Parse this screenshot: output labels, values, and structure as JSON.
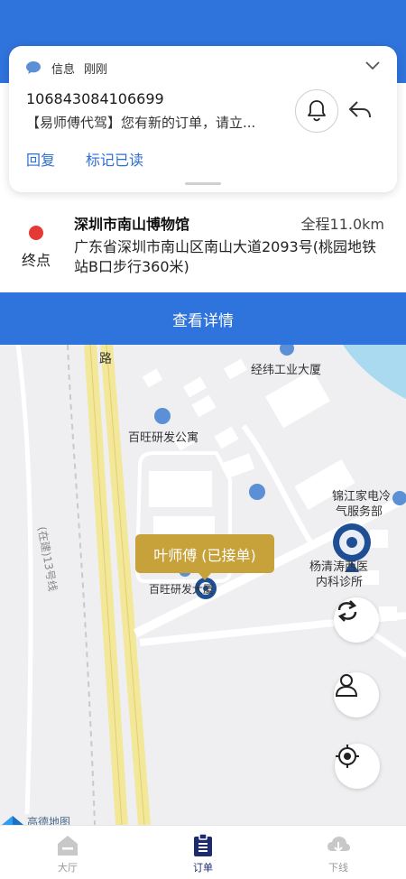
{
  "notification": {
    "app": "信息",
    "time": "刚刚",
    "sender": "106843084106699",
    "message": "【易师傅代驾】您有新的订单，请立...",
    "actions": {
      "reply": "回复",
      "mark_read": "标记已读"
    }
  },
  "destination": {
    "name": "深圳市南山博物馆",
    "distance": "全程11.0km",
    "label": "终点",
    "address": "广东省深圳市南山区南山大道2093号(桃园地铁站B口步行360米)"
  },
  "detail_button": "查看详情",
  "map": {
    "labels": {
      "road": "路",
      "bldg1": "经纬工业大厦",
      "bldg2": "百旺研发公寓",
      "bldg3": "锦江家电冷",
      "bldg3b": "气服务部",
      "clinic": "杨清涛西医",
      "clinic2": "内科诊所",
      "bldg4": "百旺研发大厦",
      "metro": "(在建)13号线"
    },
    "driver_tag": "叶师傅 (已接单)",
    "attribution": "高德地图"
  },
  "tabs": [
    {
      "label": "大厅",
      "icon": "hall-icon",
      "active": false
    },
    {
      "label": "订单",
      "icon": "order-icon",
      "active": true
    },
    {
      "label": "下线",
      "icon": "offline-icon",
      "active": false
    }
  ],
  "colors": {
    "primary": "#2f73dc",
    "tag": "#c7a13a",
    "dot": "#e53935",
    "active_tab": "#1e2a6e"
  }
}
